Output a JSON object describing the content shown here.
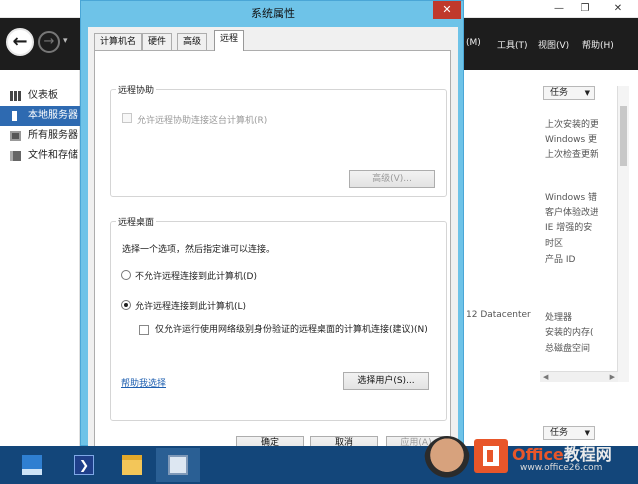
{
  "background_window": {
    "title_controls": {
      "minimize": "—",
      "maximize": "❐",
      "close": "✕"
    },
    "nav": {
      "back_icon": "arrow-left-icon",
      "back_glyph": "←",
      "forward_glyph": "→",
      "dropdown_glyph": "▾"
    },
    "menu": [
      "(M)",
      "工具(T)",
      "视图(V)",
      "帮助(H)"
    ],
    "sidebar": [
      "仪表板",
      "本地服务器",
      "所有服务器",
      "文件和存储"
    ],
    "tasks_label": "任务",
    "tasks_arrow": "▼",
    "right_lines": [
      "上次安装的更",
      "Windows 更",
      "上次检查更新",
      "Windows 错",
      "客户体验改进",
      "IE 增强的安",
      "时区",
      "产品 ID",
      "处理器",
      "安装的内存(",
      "总磁盘空间"
    ],
    "datacenter_text": "12 Datacenter",
    "hscroll": {
      "left": "◀",
      "right": "▶"
    }
  },
  "dialog": {
    "title": "系统属性",
    "close_glyph": "✕",
    "tabs": [
      "计算机名",
      "硬件",
      "高级",
      "远程"
    ],
    "active_tab": "远程",
    "remote_assistance": {
      "title": "远程协助",
      "allow_label": "允许远程协助连接这台计算机(R)",
      "advanced_button": "高级(V)..."
    },
    "remote_desktop": {
      "title": "远程桌面",
      "description": "选择一个选项，然后指定谁可以连接。",
      "option_deny": "不允许远程连接到此计算机(D)",
      "option_allow": "允许远程连接到此计算机(L)",
      "nla_label": "仅允许运行使用网络级别身份验证的远程桌面的计算机连接(建议)(N)",
      "help_link": "帮助我选择",
      "select_users_button": "选择用户(S)..."
    },
    "buttons": {
      "ok": "确定",
      "cancel": "取消",
      "apply": "应用(A)"
    }
  },
  "taskbar": {
    "ps_glyph": "❯"
  },
  "watermark": {
    "line1_accent": "Office",
    "line1_rest": "教程网",
    "line2": "www.office26.com"
  }
}
